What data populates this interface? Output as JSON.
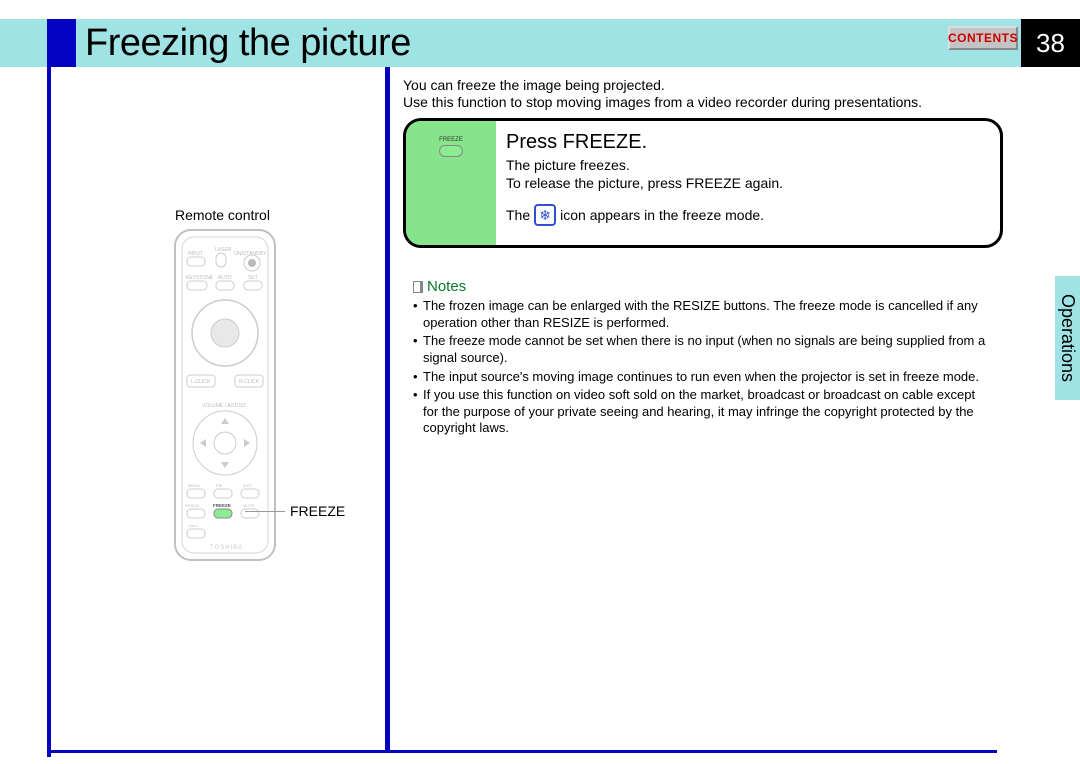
{
  "header": {
    "title": "Freezing the picture",
    "contents_btn": "CONTENTS",
    "page_num": "38"
  },
  "side_tab": "Operations",
  "remote": {
    "label": "Remote control",
    "freeze_callout": "FREEZE",
    "brand": "TOSHIBA"
  },
  "intro": {
    "line1": "You can freeze the image being projected.",
    "line2": "Use this function to stop moving images from a video recorder during presentations."
  },
  "freeze_box": {
    "button_tiny": "FREEZE",
    "title": "Press FREEZE.",
    "sub1": "The picture freezes.",
    "sub2": "To release the picture, press FREEZE again.",
    "icon_line_pre": "The",
    "icon_line_post": "icon appears in the freeze mode."
  },
  "notes": {
    "heading": "Notes",
    "items": [
      "The frozen image can be enlarged with the RESIZE buttons. The freeze mode is cancelled if any operation other than RESIZE is performed.",
      "The freeze mode cannot be set when there is no input (when no signals are being supplied from a signal source).",
      "The input source's moving image continues to run even when the projector is set in freeze mode.",
      "If you use this function on video soft sold on the market, broadcast or broadcast on cable except for the purpose of your private seeing and hearing, it may infringe the copyright protected by the copyright laws."
    ]
  }
}
